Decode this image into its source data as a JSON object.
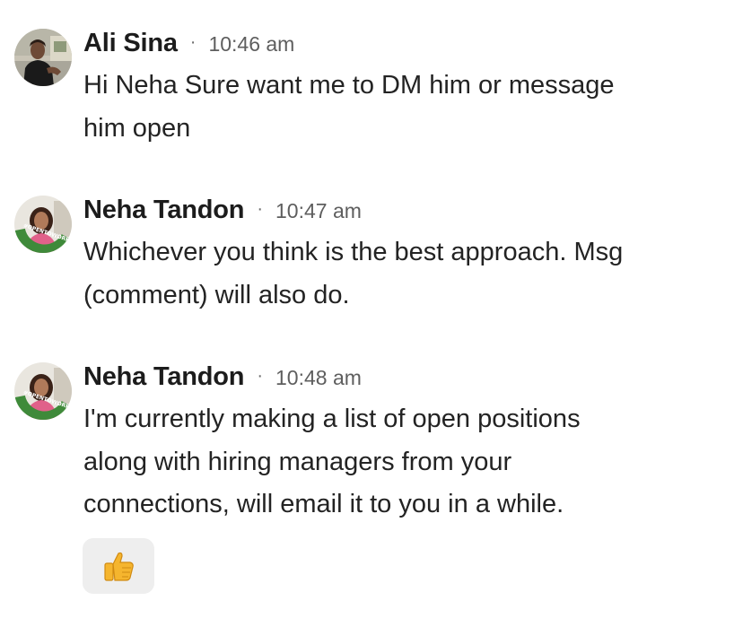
{
  "messages": [
    {
      "sender": "Ali Sina",
      "separator": "·",
      "time": "10:46 am",
      "lines": [
        "Hi Neha Sure want me to DM him or message",
        "him open"
      ]
    },
    {
      "sender": "Neha Tandon",
      "separator": "·",
      "time": "10:47 am",
      "lines": [
        "Whichever you think is the best approach. Msg",
        "(comment) will also do."
      ],
      "avatar_badge": "#OPENTOWORK"
    },
    {
      "sender": "Neha Tandon",
      "separator": "·",
      "time": "10:48 am",
      "lines": [
        "I'm currently making a list of open positions",
        "along with hiring managers from your",
        "connections, will email it to you in a while."
      ],
      "avatar_badge": "#OPENTOWORK",
      "reaction_icon": "thumbs-up-icon"
    }
  ],
  "colors": {
    "open_to_work_ring": "#3f8a3a",
    "reaction_bg": "#eeeeee",
    "thumb": "#f5b52e"
  }
}
